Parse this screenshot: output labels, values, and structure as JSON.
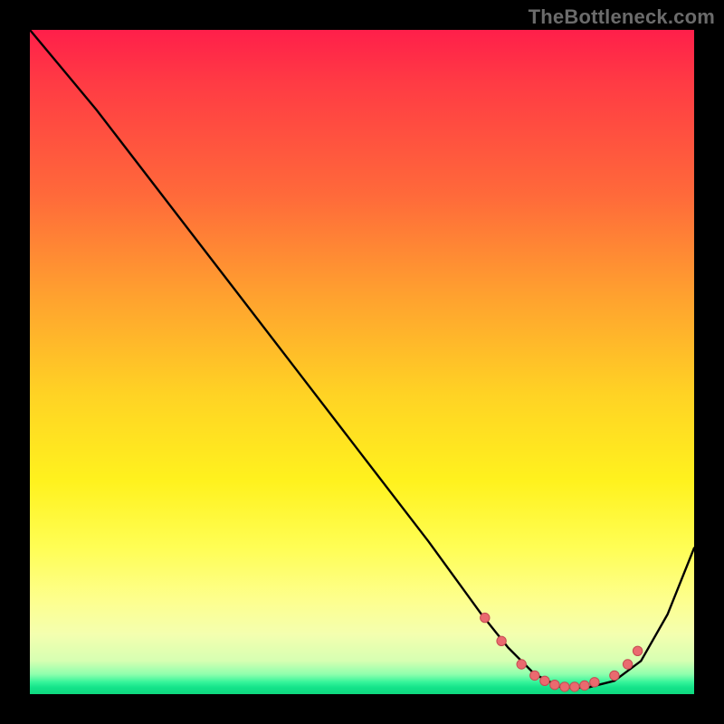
{
  "attribution": "TheBottleneck.com",
  "colors": {
    "frame": "#000000",
    "curve": "#000000",
    "marker_fill": "#ea6a6f",
    "marker_stroke": "#c54c52",
    "gradient_top": "#ff1f4a",
    "gradient_mid1": "#ffa12f",
    "gradient_mid2": "#fff21e",
    "gradient_bottom": "#0fd97f"
  },
  "chart_data": {
    "type": "line",
    "title": "",
    "xlabel": "",
    "ylabel": "",
    "xlim": [
      0,
      100
    ],
    "ylim": [
      0,
      100
    ],
    "series": [
      {
        "name": "bottleneck-curve",
        "x": [
          0,
          5,
          10,
          20,
          30,
          40,
          50,
          60,
          68,
          72,
          76,
          80,
          84,
          88,
          92,
          96,
          100
        ],
        "values": [
          100,
          94,
          88,
          75,
          62,
          49,
          36,
          23,
          12,
          7,
          3,
          1,
          1,
          2,
          5,
          12,
          22
        ]
      }
    ],
    "markers": {
      "name": "highlight-dots",
      "x": [
        68.5,
        71,
        74,
        76,
        77.5,
        79,
        80.5,
        82,
        83.5,
        85,
        88,
        90,
        91.5
      ],
      "values": [
        11.5,
        8,
        4.5,
        2.8,
        2,
        1.4,
        1.1,
        1.1,
        1.3,
        1.8,
        2.8,
        4.5,
        6.5
      ]
    }
  }
}
